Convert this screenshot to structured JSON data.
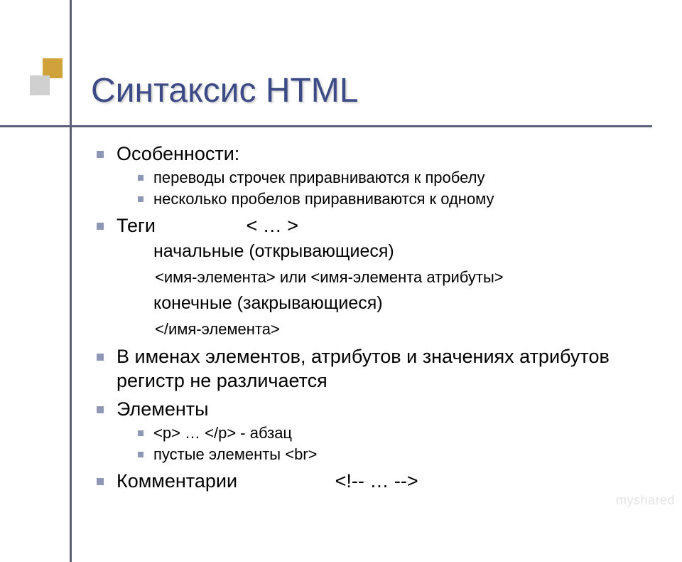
{
  "title": "Синтаксис HTML",
  "items": [
    {
      "label": "Особенности:",
      "sub": [
        "переводы строчек приравниваются к пробелу",
        "несколько пробелов приравниваются к одному"
      ]
    },
    {
      "label": "Теги",
      "tag_note": "< … >",
      "sub_detailed": [
        {
          "bullet": "начальные (открывающиеся)",
          "detail_a": "<имя-элемента>",
          "detail_mid": " или ",
          "detail_b": "<имя-элемента атрибуты>"
        },
        {
          "bullet": "конечные (закрывающиеся)",
          "detail_a": "</имя-элемента>"
        }
      ]
    },
    {
      "label": "В именах элементов, атрибутов и значениях атрибутов регистр не различается"
    },
    {
      "label": "Элементы",
      "sub": [
        "<p> … </p> - абзац",
        "пустые элементы <br>"
      ]
    },
    {
      "label": "Комментарии",
      "comment_note": "<!-- … -->"
    }
  ],
  "watermark": "myshared"
}
